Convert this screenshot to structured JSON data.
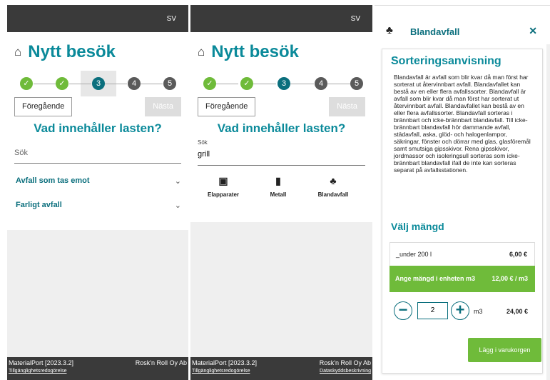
{
  "language": "SV",
  "page_title": "Nytt besök",
  "steps": [
    {
      "label": "✓",
      "state": "done"
    },
    {
      "label": "✓",
      "state": "done"
    },
    {
      "label": "3",
      "state": "active"
    },
    {
      "label": "4",
      "state": "todo"
    },
    {
      "label": "5",
      "state": "todo"
    }
  ],
  "nav": {
    "prev": "Föregående",
    "next": "Nästa"
  },
  "question": "Vad innehåller lasten?",
  "search": {
    "placeholder": "Sök",
    "label": "Sök",
    "value": "grill"
  },
  "accordions": [
    {
      "label": "Avfall som tas emot"
    },
    {
      "label": "Farligt avfall"
    }
  ],
  "results": [
    {
      "name": "Elapparater",
      "icon": "battery-icon"
    },
    {
      "name": "Metall",
      "icon": "barrel-icon"
    },
    {
      "name": "Blandavfall",
      "icon": "mixed-waste-icon"
    }
  ],
  "footer": {
    "app_version": "MaterialPort [2023.3.2]",
    "accessibility": "Tillgänglighetsredogörelse",
    "company": "Rosk'n Roll Oy Ab",
    "privacy": "Dataskyddsbeskrivning"
  },
  "detail": {
    "title": "Blandavfall",
    "close": "✕",
    "section_title": "Sorteringsanvisning",
    "description": "Blandavfall är avfall som blir kvar då man först har sorterat ut återvinnbart avfall. Blandavfallet kan bestå av en eller flera avfallssorter. Blandavfall är avfall som blir kvar då man först har sorterat ut återvinnbart avfall. Blandavfallet kan bestå av en eller flera avfallssorter. Blandavfall sorteras i brännbart och icke-brännbart blandavfall. Till icke-brännbart blandavfall hör dammande avfall, städavfall, aska, glöd- och halogenlampor, säkringar, fönster och dörrar med glas, glasföremål samt smutsiga gipsskivor. Rena gipsskivor, jordmassor och isoleringsull sorteras som icke-brännbart blandavfall ifall de inte kan sorteras separat på avfallsstationen.",
    "quantity_title": "Välj mängd",
    "option1_label": "_under 200 l",
    "option1_price": "6,00 €",
    "option2_label": "Ange mängd i enheten m3",
    "option2_price": "12,00 € / m3",
    "qty_value": "2",
    "qty_unit": "m3",
    "qty_total": "24,00 €",
    "add_button": "Lägg i varukorgen"
  },
  "colors": {
    "accent": "#0b8a9a",
    "green": "#6fbb3a",
    "dark": "#3a3a3a"
  }
}
